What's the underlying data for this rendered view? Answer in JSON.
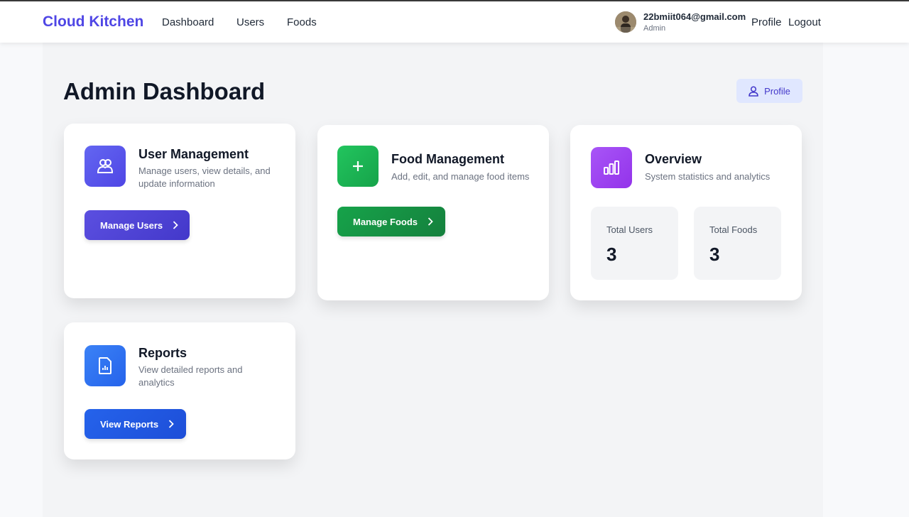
{
  "navbar": {
    "brand": "Cloud Kitchen",
    "links": [
      "Dashboard",
      "Users",
      "Foods"
    ],
    "user_email": "22bmiit064@gmail.com",
    "user_role": "Admin",
    "profile_label": "Profile",
    "logout_label": "Logout"
  },
  "page": {
    "title": "Admin Dashboard",
    "profile_button": "Profile"
  },
  "cards": {
    "users": {
      "title": "User Management",
      "description": "Manage users, view details, and update information",
      "button": "Manage Users",
      "icon": "users-icon",
      "color": "#4f46e5"
    },
    "foods": {
      "title": "Food Management",
      "description": "Add, edit, and manage food items",
      "button": "Manage Foods",
      "icon": "plus-icon",
      "color": "#16a34a"
    },
    "overview": {
      "title": "Overview",
      "description": "System statistics and analytics",
      "icon": "bar-chart-icon",
      "color": "#9333ea",
      "stats": [
        {
          "label": "Total Users",
          "value": "3"
        },
        {
          "label": "Total Foods",
          "value": "3"
        }
      ]
    },
    "reports": {
      "title": "Reports",
      "description": "View detailed reports and analytics",
      "button": "View Reports",
      "icon": "report-file-icon",
      "color": "#2563eb"
    }
  }
}
